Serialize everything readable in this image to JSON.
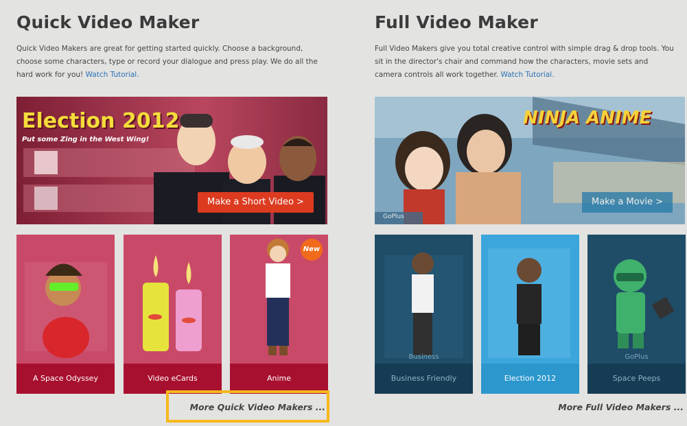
{
  "quick": {
    "title": "Quick Video Maker",
    "description": "Quick Video Makers are great for getting started quickly. Choose a background, choose some characters, type or record your dialogue and press play. We do all the hard work for you!",
    "tutorial_link": "Watch Tutorial.",
    "hero": {
      "headline": "Election 2012",
      "subline": "Put some Zing in the West Wing!",
      "button": "Make a Short Video >"
    },
    "cards": [
      {
        "label": "A Space Odyssey"
      },
      {
        "label": "Video eCards"
      },
      {
        "label": "Anime",
        "badge": "New"
      }
    ],
    "more_link": "More Quick Video Makers ..."
  },
  "full": {
    "title": "Full Video Maker",
    "description": "Full Video Makers give you total creative control with simple drag & drop tools. You sit in the director's chair and command how the characters, movie sets and camera controls all work together.",
    "tutorial_link": "Watch Tutorial.",
    "hero": {
      "headline": "NINJA ANIME",
      "tag": "GoPlus",
      "button": "Make a Movie >"
    },
    "cards": [
      {
        "label": "Business Friendly",
        "tag": "Business"
      },
      {
        "label": "Election 2012"
      },
      {
        "label": "Space Peeps",
        "tag": "GoPlus"
      }
    ],
    "more_link": "More Full Video Makers ..."
  },
  "colors": {
    "quick_card": "#c94a68",
    "quick_caption": "#a8102f",
    "full_card": "#1f4d68",
    "full_caption": "#163c55",
    "full_active": "#3aa6dc",
    "link": "#2a72b5",
    "highlight": "#f6b81c",
    "hero_button_red": "#dc3b20",
    "hero_button_blue": "#2579a8"
  }
}
